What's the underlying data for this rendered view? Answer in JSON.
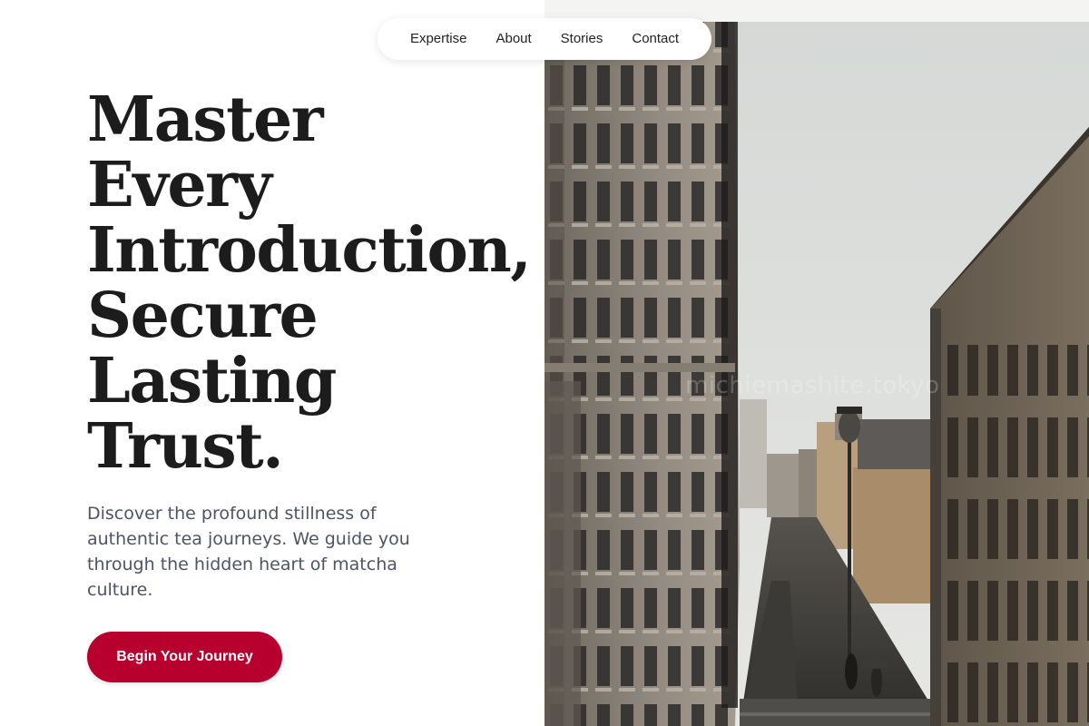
{
  "nav": {
    "links": [
      "Expertise",
      "About",
      "Stories",
      "Contact"
    ]
  },
  "hero": {
    "title_lines": [
      "Master",
      "Every",
      "Introduction,",
      "Secure",
      "Lasting",
      "Trust."
    ],
    "subtitle": "Discover the profound stillness of authentic tea journeys. We guide you through the hidden heart of matcha culture.",
    "cta_label": "Begin Your Journey"
  },
  "photo": {
    "watermark": "michiemashite.tokyo"
  },
  "colors": {
    "accent": "#b8002e",
    "heading": "#1c1c1c",
    "body_text": "#4b5563",
    "background": "#ffffff"
  }
}
